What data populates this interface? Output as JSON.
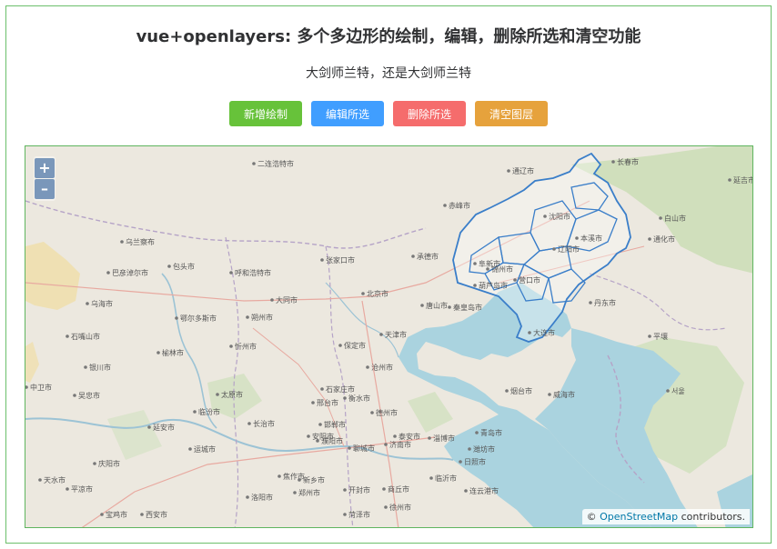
{
  "page": {
    "title": "vue+openlayers: 多个多边形的绘制，编辑，删除所选和清空功能",
    "subtitle": "大剑师兰特，还是大剑师兰特"
  },
  "toolbar": {
    "new_label": "新增绘制",
    "edit_label": "编辑所选",
    "delete_label": "删除所选",
    "clear_label": "清空图层"
  },
  "colors": {
    "new": "#67c23a",
    "edit": "#409eff",
    "delete": "#f56c6c",
    "clear": "#e6a23c",
    "polygon_stroke": "#3a7ec9"
  },
  "map": {
    "zoom_in": "+",
    "zoom_out": "–",
    "attribution_prefix": "©",
    "attribution_link": "OpenStreetMap",
    "attribution_suffix": "contributors.",
    "places": [
      "二连浩特市",
      "乌兰察布",
      "呼和浩特市",
      "包头市",
      "巴彦淖尔市",
      "乌海市",
      "鄂尔多斯市",
      "大同市",
      "张家口市",
      "北京市",
      "天津市",
      "唐山市",
      "承德市",
      "赤峰市",
      "阜新市",
      "沈阳市",
      "锦州市",
      "葫芦岛市",
      "秦皇岛市",
      "营口市",
      "大连市",
      "丹东市",
      "本溪市",
      "辽阳市",
      "通化市",
      "白山市",
      "延吉市",
      "通辽市",
      "长春市",
      "平壤",
      "서울",
      "朔州市",
      "忻州市",
      "太原市",
      "石家庄市",
      "保定市",
      "沧州市",
      "德州市",
      "济南市",
      "淄博市",
      "潍坊市",
      "青岛市",
      "烟台市",
      "威海市",
      "日照市",
      "临沂市",
      "徐州市",
      "连云港市",
      "郑州市",
      "开封市",
      "洛阳市",
      "西安市",
      "延安市",
      "榆林市",
      "银川市",
      "中卫市",
      "吴忠市",
      "石嘴山市",
      "临汾市",
      "长治市",
      "邯郸市",
      "邢台市",
      "衡水市",
      "聊城市",
      "泰安市",
      "菏泽市",
      "商丘市",
      "新乡市",
      "焦作市",
      "安阳市",
      "濮阳市",
      "运城市",
      "天水市",
      "庆阳市",
      "平凉市",
      "宝鸡市"
    ]
  }
}
